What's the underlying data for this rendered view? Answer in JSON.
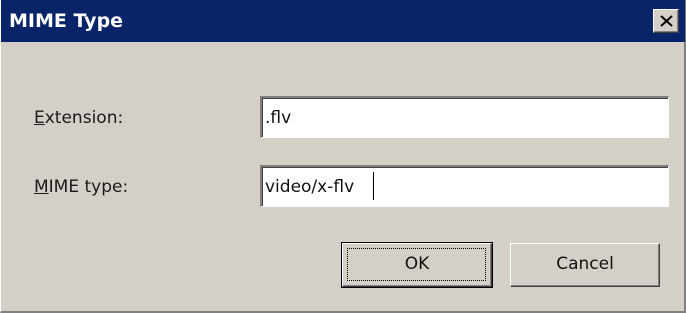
{
  "window": {
    "title": "MIME Type",
    "close_icon": "close-x-icon"
  },
  "form": {
    "extension": {
      "label_mnemonic": "E",
      "label_rest": "xtension:",
      "value": ".flv"
    },
    "mime_type": {
      "label_mnemonic": "M",
      "label_rest": "IME type:",
      "value": "video/x-flv"
    }
  },
  "buttons": {
    "ok_label": "OK",
    "cancel_label": "Cancel"
  },
  "colors": {
    "titlebar": "#0a246a",
    "dialog_face": "#d4d0c8",
    "field_background": "#ffffff"
  }
}
